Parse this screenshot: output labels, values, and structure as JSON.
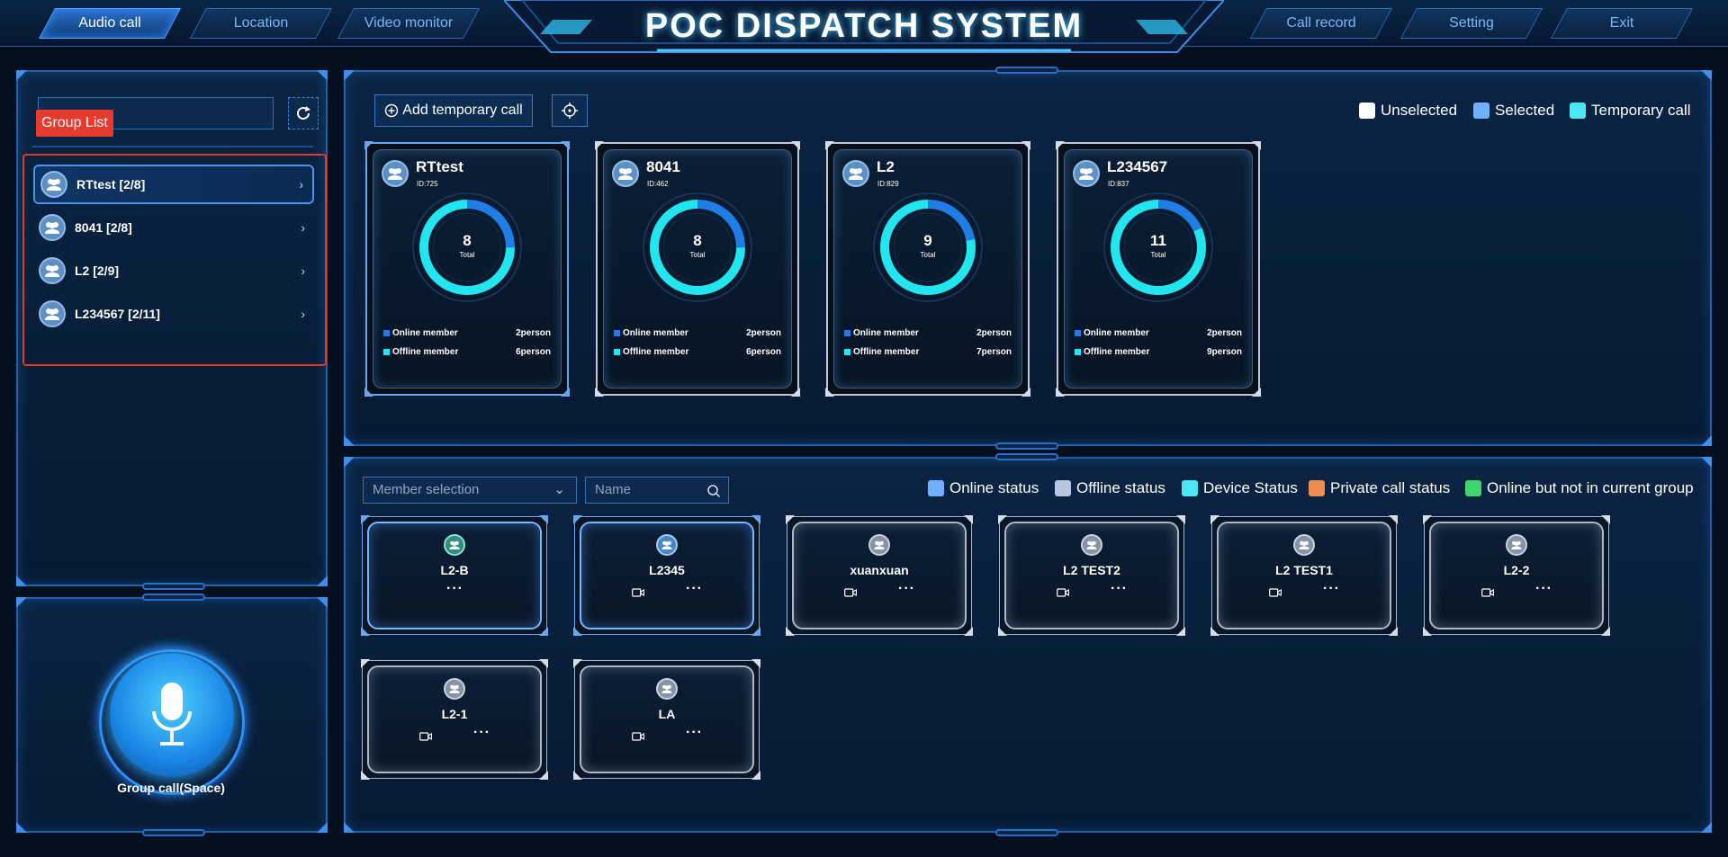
{
  "header": {
    "title": "POC DISPATCH SYSTEM",
    "tabs_left": [
      "Audio call",
      "Location",
      "Video monitor"
    ],
    "tabs_right": [
      "Call record",
      "Setting",
      "Exit"
    ],
    "active_tab": "Audio call"
  },
  "sidebar": {
    "tooltip": "Group List",
    "search_placeholder": "",
    "groups": [
      {
        "label": "RTtest [2/8]",
        "active": true
      },
      {
        "label": "8041 [2/8]",
        "active": false
      },
      {
        "label": "L2 [2/9]",
        "active": false
      },
      {
        "label": "L234567 [2/11]",
        "active": false
      }
    ],
    "group_call_label": "Group call(Space)"
  },
  "group_panel": {
    "add_temp_call": "Add temporary call",
    "legend": [
      {
        "label": "Unselected",
        "color": "#ffffff"
      },
      {
        "label": "Selected",
        "color": "#6fb0ff"
      },
      {
        "label": "Temporary call",
        "color": "#4de6f5"
      }
    ],
    "cards": [
      {
        "name": "RTtest",
        "id": "ID:725",
        "total": 8,
        "online_label": "Online member",
        "online": "2person",
        "offline_label": "Offline member",
        "offline": "6person",
        "online_count": 2,
        "selected": true
      },
      {
        "name": "8041",
        "id": "ID:462",
        "total": 8,
        "online_label": "Online member",
        "online": "2person",
        "offline_label": "Offline member",
        "offline": "6person",
        "online_count": 2,
        "selected": false
      },
      {
        "name": "L2",
        "id": "ID:829",
        "total": 9,
        "online_label": "Online member",
        "online": "2person",
        "offline_label": "Offline member",
        "offline": "7person",
        "online_count": 2,
        "selected": false
      },
      {
        "name": "L234567",
        "id": "ID:837",
        "total": 11,
        "online_label": "Online member",
        "online": "2person",
        "offline_label": "Offline member",
        "offline": "9person",
        "online_count": 2,
        "selected": false
      }
    ],
    "total_label": "Total"
  },
  "member_panel": {
    "member_select_placeholder": "Member selection",
    "name_placeholder": "Name",
    "legend": [
      {
        "label": "Online status",
        "color": "#6fb0ff"
      },
      {
        "label": "Offline status",
        "color": "#b6c6e0"
      },
      {
        "label": "Device Status",
        "color": "#4de6f5"
      },
      {
        "label": "Private call status",
        "color": "#f08a50"
      },
      {
        "label": "Online but not in current group",
        "color": "#3fd36b"
      }
    ],
    "members": [
      {
        "name": "L2-B",
        "status": "device",
        "camera": false
      },
      {
        "name": "L2345",
        "status": "online",
        "camera": true
      },
      {
        "name": "xuanxuan",
        "status": "offline",
        "camera": true
      },
      {
        "name": "L2 TEST2",
        "status": "offline",
        "camera": true
      },
      {
        "name": "L2 TEST1",
        "status": "offline",
        "camera": true
      },
      {
        "name": "L2-2",
        "status": "offline",
        "camera": true
      },
      {
        "name": "L2-1",
        "status": "offline",
        "camera": true
      },
      {
        "name": "LA",
        "status": "offline",
        "camera": true
      }
    ],
    "more_glyph": "···"
  }
}
